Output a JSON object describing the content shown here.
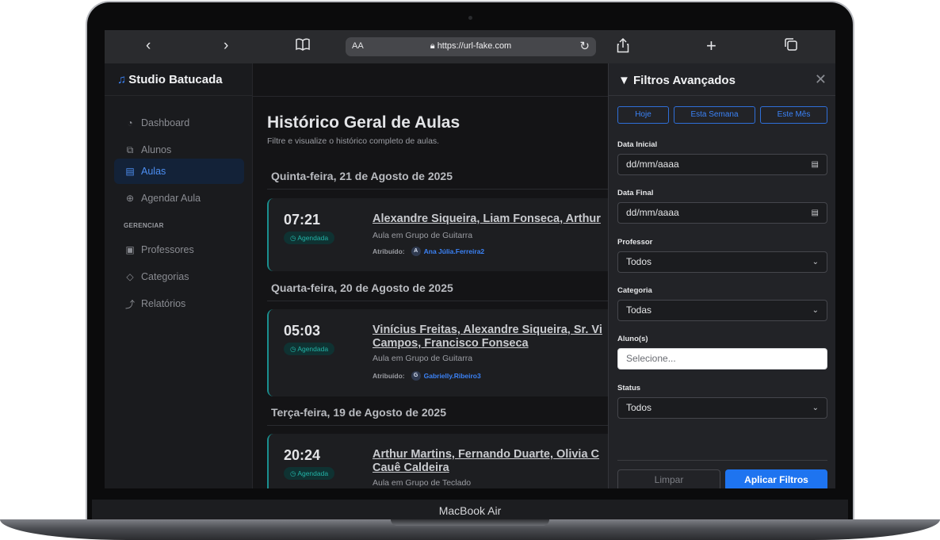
{
  "device": {
    "label": "MacBook Air"
  },
  "browser": {
    "text_size_label": "AA",
    "url": "https://url-fake.com"
  },
  "sidebar": {
    "brand": "Studio Batucada",
    "items": [
      {
        "label": "Dashboard",
        "icon": "dashboard-icon",
        "active": false
      },
      {
        "label": "Alunos",
        "icon": "users-icon",
        "active": false
      },
      {
        "label": "Aulas",
        "icon": "list-icon",
        "active": true
      },
      {
        "label": "Agendar Aula",
        "icon": "plus-circle-icon",
        "active": false
      }
    ],
    "section_label": "GERENCIAR",
    "manage_items": [
      {
        "label": "Professores",
        "icon": "board-icon"
      },
      {
        "label": "Categorias",
        "icon": "tag-icon"
      },
      {
        "label": "Relatórios",
        "icon": "chart-icon"
      }
    ]
  },
  "main": {
    "title": "Histórico Geral de Aulas",
    "subtitle": "Filtre e visualize o histórico completo de aulas.",
    "groups": [
      {
        "date": "Quinta-feira, 21 de Agosto de 2025",
        "lessons": [
          {
            "time": "07:21",
            "status": "Agendada",
            "names_line1": "Alexandre Siqueira, Liam Fonseca, Arthur",
            "names_line2": "",
            "description": "Aula em Grupo de Guitarra",
            "assigned_label": "Atribuído:",
            "assignee_initial": "A",
            "assignee": "Ana Júlia.Ferreira2"
          }
        ]
      },
      {
        "date": "Quarta-feira, 20 de Agosto de 2025",
        "lessons": [
          {
            "time": "05:03",
            "status": "Agendada",
            "names_line1": "Vinícius Freitas, Alexandre Siqueira, Sr. Vi",
            "names_line2": "Campos, Francisco Fonseca",
            "description": "Aula em Grupo de Guitarra",
            "assigned_label": "Atribuído:",
            "assignee_initial": "G",
            "assignee": "Gabrielly.Ribeiro3"
          }
        ]
      },
      {
        "date": "Terça-feira, 19 de Agosto de 2025",
        "lessons": [
          {
            "time": "20:24",
            "status": "Agendada",
            "names_line1": "Arthur Martins, Fernando Duarte, Olivia C",
            "names_line2": "Cauê Caldeira",
            "description": "Aula em Grupo de Teclado"
          }
        ]
      }
    ]
  },
  "filters": {
    "title": "Filtros Avançados",
    "quick": [
      "Hoje",
      "Esta Semana",
      "Este Mês"
    ],
    "start_date": {
      "label": "Data Inicial",
      "value": "dd/mm/aaaa"
    },
    "end_date": {
      "label": "Data Final",
      "value": "dd/mm/aaaa"
    },
    "teacher": {
      "label": "Professor",
      "value": "Todos"
    },
    "category": {
      "label": "Categoria",
      "value": "Todas"
    },
    "students": {
      "label": "Aluno(s)",
      "placeholder": "Selecione..."
    },
    "status": {
      "label": "Status",
      "value": "Todos"
    },
    "clear_label": "Limpar",
    "apply_label": "Aplicar Filtros"
  },
  "colors": {
    "accent": "#3b82f6",
    "apply": "#1e74f0",
    "status_teal": "#22b3a6",
    "card_border": "#1a8f8f"
  }
}
